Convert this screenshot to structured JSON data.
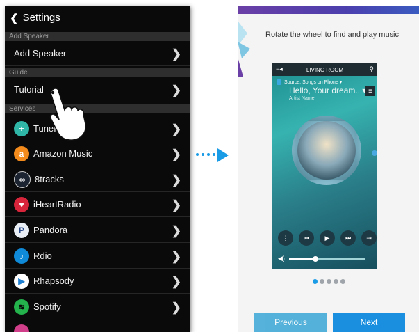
{
  "settings": {
    "back_glyph": "❮",
    "title": "Settings",
    "sections": [
      {
        "label": "Add Speaker"
      },
      {
        "label": "Guide"
      },
      {
        "label": "Services"
      }
    ],
    "rows": {
      "add_speaker": "Add Speaker",
      "tutorial": "Tutorial",
      "services": [
        {
          "label": "TuneIn",
          "icon": "tunein-icon",
          "color": "#2fb6a7",
          "glyph": "+"
        },
        {
          "label": "Amazon Music",
          "icon": "amazon-music-icon",
          "color": "#f28a1c",
          "glyph": "a"
        },
        {
          "label": "8tracks",
          "icon": "8tracks-icon",
          "color": "#1b2430",
          "glyph": "∞"
        },
        {
          "label": "iHeartRadio",
          "icon": "iheartradio-icon",
          "color": "#d9253b",
          "glyph": "♥"
        },
        {
          "label": "Pandora",
          "icon": "pandora-icon",
          "color": "#e9eef5",
          "glyph": "P"
        },
        {
          "label": "Rdio",
          "icon": "rdio-icon",
          "color": "#0f8ad9",
          "glyph": "♪"
        },
        {
          "label": "Rhapsody",
          "icon": "rhapsody-icon",
          "color": "#ffffff",
          "glyph": "▶"
        },
        {
          "label": "Spotify",
          "icon": "spotify-icon",
          "color": "#23b24c",
          "glyph": "≋"
        }
      ],
      "chevron": "❯"
    }
  },
  "tutorial": {
    "instruction": "Rotate the wheel to find and play music",
    "phone": {
      "room": "LIVING ROOM",
      "queue_icon": "≡◂",
      "search_icon": "⚲",
      "source": "Source: Songs on Phone ▾",
      "song": "Hello, Your dream..  ▾",
      "artist": "Artist Name",
      "menu_icon": "≡",
      "controls": [
        "⋮",
        "⏮",
        "▶",
        "⏭",
        "⇥"
      ],
      "volume_icon": "◀)",
      "volume_level": 0.35
    },
    "pager": {
      "count": 5,
      "active": 0
    },
    "previous_label": "Previous",
    "next_label": "Next"
  },
  "colors": {
    "accent": "#1a9be6"
  }
}
